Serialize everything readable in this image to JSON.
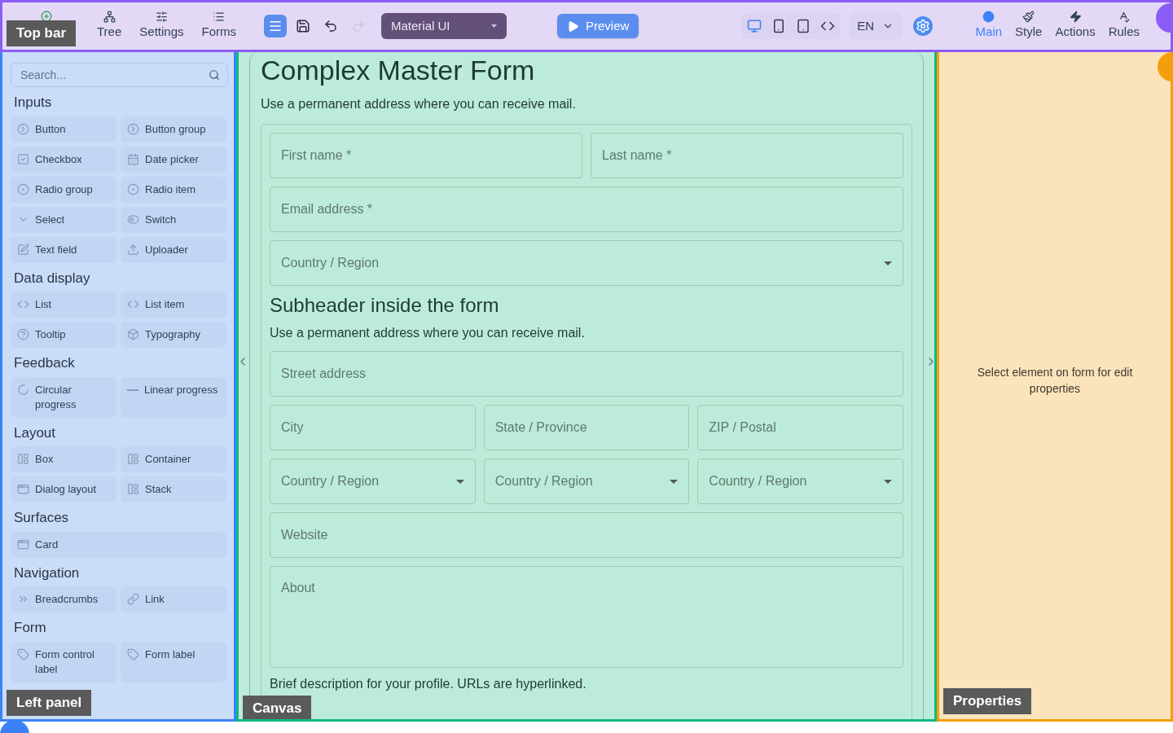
{
  "top_bar": {
    "overlay_label": "Top bar",
    "left_tabs": [
      {
        "kind": "add"
      },
      {
        "label": "Tree",
        "kind": "tree"
      },
      {
        "label": "Settings",
        "kind": "settings"
      },
      {
        "label": "Forms",
        "kind": "forms"
      }
    ],
    "tools": [
      {
        "kind": "menu",
        "selected": true,
        "disabled": false
      },
      {
        "kind": "save",
        "selected": false,
        "disabled": false
      },
      {
        "kind": "undo",
        "selected": false,
        "disabled": false
      },
      {
        "kind": "redo",
        "selected": false,
        "disabled": true
      }
    ],
    "theme_select": "Material UI",
    "preview": "Preview",
    "devices": [
      {
        "kind": "desktop",
        "selected": true
      },
      {
        "kind": "phone",
        "selected": false
      },
      {
        "kind": "tablet",
        "selected": false
      },
      {
        "kind": "code",
        "selected": false
      }
    ],
    "language": "EN",
    "right_tabs": [
      {
        "label": "Main",
        "kind": "main",
        "selected": true
      },
      {
        "label": "Style",
        "kind": "style",
        "selected": false
      },
      {
        "label": "Actions",
        "kind": "actions",
        "selected": false
      },
      {
        "label": "Rules",
        "kind": "rules",
        "selected": false
      }
    ]
  },
  "left_panel": {
    "overlay_label": "Left panel",
    "search": {
      "placeholder": "Search..."
    },
    "sections": [
      {
        "title": "Inputs",
        "items": [
          {
            "label": "Button",
            "kind": "button"
          },
          {
            "label": "Button group",
            "kind": "button"
          },
          {
            "label": "Checkbox",
            "kind": "checkbox"
          },
          {
            "label": "Date picker",
            "kind": "date"
          },
          {
            "label": "Radio group",
            "kind": "radio"
          },
          {
            "label": "Radio item",
            "kind": "radio"
          },
          {
            "label": "Select",
            "kind": "select"
          },
          {
            "label": "Switch",
            "kind": "switch"
          },
          {
            "label": "Text field",
            "kind": "textfield"
          },
          {
            "label": "Uploader",
            "kind": "upload"
          }
        ]
      },
      {
        "title": "Data display",
        "items": [
          {
            "label": "List",
            "kind": "code"
          },
          {
            "label": "List item",
            "kind": "code"
          },
          {
            "label": "Tooltip",
            "kind": "help"
          },
          {
            "label": "Typography",
            "kind": "cube"
          }
        ]
      },
      {
        "title": "Feedback",
        "items": [
          {
            "label": "Circular progress",
            "kind": "spinner"
          },
          {
            "label": "Linear progress",
            "kind": "line"
          }
        ]
      },
      {
        "title": "Layout",
        "items": [
          {
            "label": "Box",
            "kind": "layout"
          },
          {
            "label": "Container",
            "kind": "layout"
          },
          {
            "label": "Dialog layout",
            "kind": "window"
          },
          {
            "label": "Stack",
            "kind": "layout"
          }
        ]
      },
      {
        "title": "Surfaces",
        "items": [
          {
            "label": "Card",
            "kind": "window",
            "wide": true
          }
        ]
      },
      {
        "title": "Navigation",
        "items": [
          {
            "label": "Breadcrumbs",
            "kind": "chevrons"
          },
          {
            "label": "Link",
            "kind": "link"
          }
        ]
      },
      {
        "title": "Form",
        "items": [
          {
            "label": "Form control label",
            "kind": "tag"
          },
          {
            "label": "Form label",
            "kind": "tag"
          }
        ]
      }
    ]
  },
  "canvas": {
    "overlay_label": "Canvas",
    "title": "Complex Master Form",
    "description": "Use a permanent address where you can receive mail.",
    "form": [
      {
        "kind": "row",
        "fields": [
          {
            "kind": "text",
            "placeholder": "First name *"
          },
          {
            "kind": "text",
            "placeholder": "Last name *"
          }
        ]
      },
      {
        "kind": "row",
        "fields": [
          {
            "kind": "text",
            "placeholder": "Email address *"
          }
        ]
      },
      {
        "kind": "row",
        "fields": [
          {
            "kind": "select",
            "placeholder": "Country / Region"
          }
        ]
      },
      {
        "kind": "subheader",
        "text": "Subheader inside the form"
      },
      {
        "kind": "paragraph",
        "text": "Use a permanent address where you can receive mail."
      },
      {
        "kind": "row",
        "fields": [
          {
            "kind": "text",
            "placeholder": "Street address"
          }
        ]
      },
      {
        "kind": "row",
        "fields": [
          {
            "kind": "text",
            "placeholder": "City"
          },
          {
            "kind": "text",
            "placeholder": "State / Province"
          },
          {
            "kind": "text",
            "placeholder": "ZIP / Postal"
          }
        ]
      },
      {
        "kind": "row",
        "fields": [
          {
            "kind": "select",
            "placeholder": "Country / Region"
          },
          {
            "kind": "select",
            "placeholder": "Country / Region"
          },
          {
            "kind": "select",
            "placeholder": "Country / Region"
          }
        ]
      },
      {
        "kind": "row",
        "fields": [
          {
            "kind": "text",
            "placeholder": "Website"
          }
        ]
      },
      {
        "kind": "row",
        "fields": [
          {
            "kind": "textarea",
            "placeholder": "About"
          }
        ]
      },
      {
        "kind": "paragraph",
        "text": "Brief description for your profile. URLs are hyperlinked."
      }
    ]
  },
  "properties": {
    "overlay_label": "Properties",
    "empty_text": "Select element on form for edit properties"
  }
}
